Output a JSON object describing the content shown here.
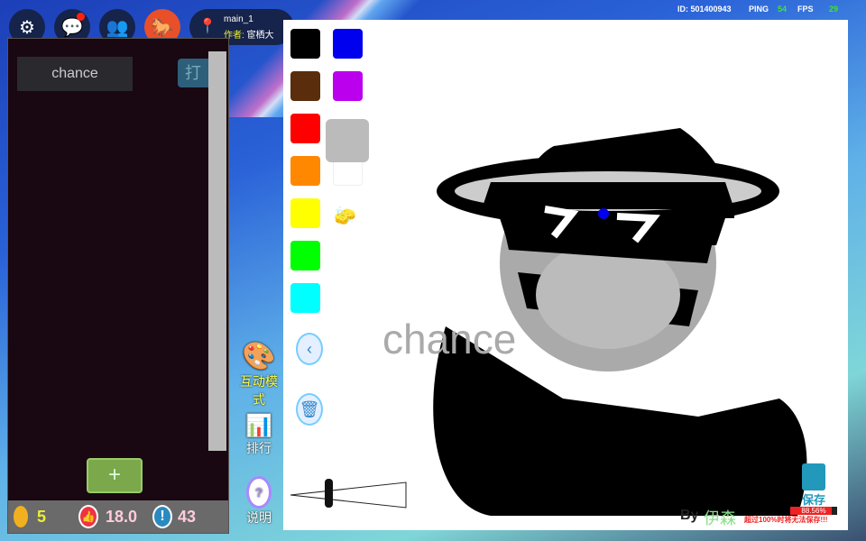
{
  "topbar": {
    "map_name": "main_1",
    "author_label": "作者:",
    "author_name": "宦栖大",
    "id_text": "ID: 501400943",
    "ping_label": "PING",
    "ping_value": "54",
    "fps_label": "FPS",
    "fps_value": "29"
  },
  "panel": {
    "input_value": "chance",
    "side_button": "打",
    "add_button": "+"
  },
  "stats": {
    "coins": "5",
    "likes": "18.0",
    "reports": "43"
  },
  "side": {
    "interactive_mode": "互动模式",
    "ranking": "排行",
    "help": "说明"
  },
  "palette": {
    "colors": [
      "#000000",
      "#0000ee",
      "#5a2d0c",
      "#bb00ee",
      "#ff0000",
      "#bbbbbb",
      "#ff8800",
      "#ffffff",
      "#ffff00",
      "#00ff00",
      "#00ffff"
    ]
  },
  "canvas": {
    "by_label": "By",
    "artist": "伊森",
    "save_label": "保存",
    "usage_percent": "88.56%",
    "usage_value": 88.56,
    "warning": "超过100%时将无法保存!!!"
  }
}
